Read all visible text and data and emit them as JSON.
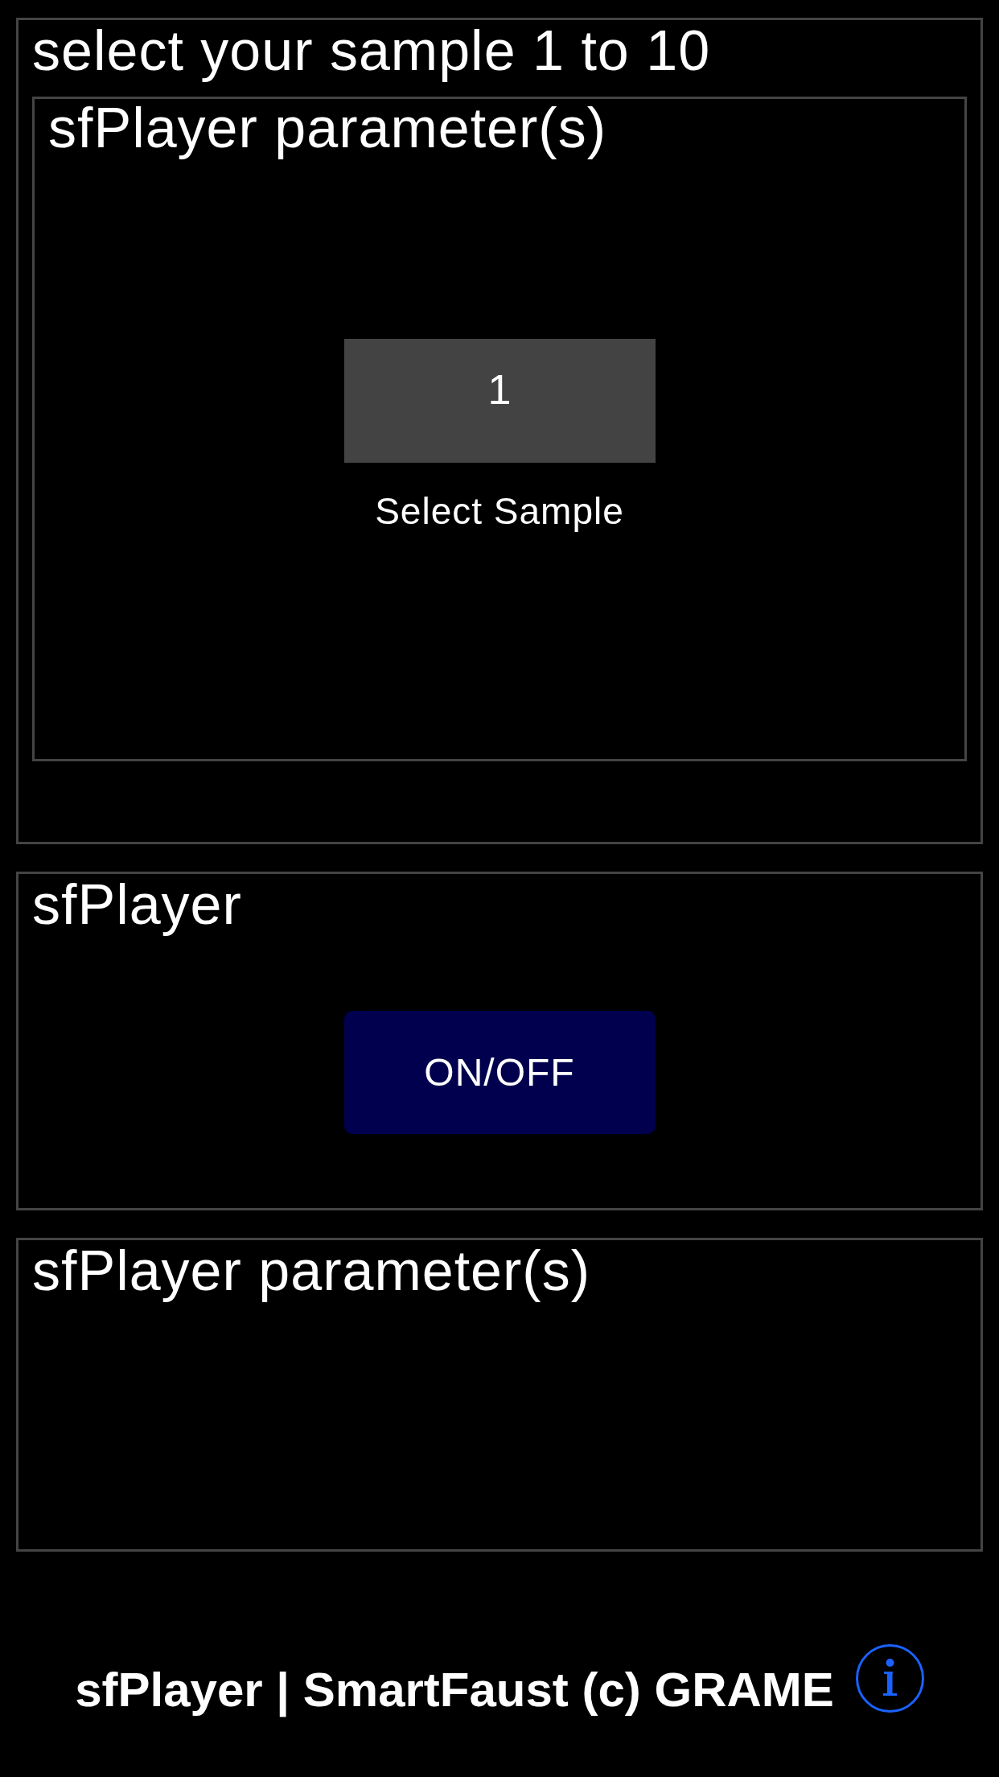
{
  "panels": [
    {
      "title": "select your sample 1 to 10",
      "children": [
        {
          "title": "sfPlayer parameter(s)",
          "controls": [
            {
              "kind": "numentry",
              "value": "1",
              "label": "Select Sample"
            }
          ]
        }
      ]
    },
    {
      "title": "sfPlayer",
      "controls": [
        {
          "kind": "button",
          "label": "ON/OFF"
        }
      ]
    },
    {
      "title": "sfPlayer parameter(s)"
    }
  ],
  "footer": {
    "text": "sfPlayer | SmartFaust (c) GRAME"
  }
}
